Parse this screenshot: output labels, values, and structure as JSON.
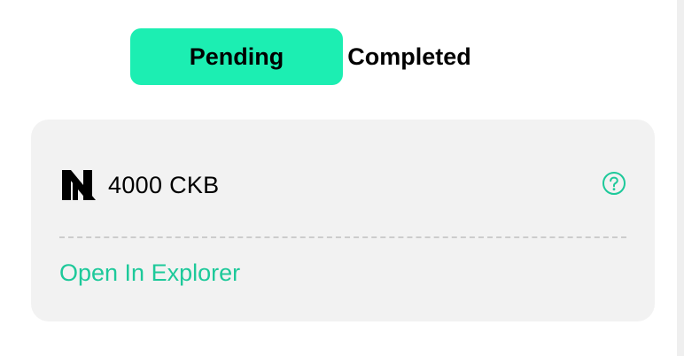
{
  "tabs": [
    {
      "label": "Pending",
      "active": true
    },
    {
      "label": "Completed",
      "active": false
    }
  ],
  "transaction": {
    "asset_icon": "nervos-logo-icon",
    "amount": "4000 CKB",
    "help_icon": "question-circle-icon",
    "explorer_link": "Open In Explorer"
  },
  "colors": {
    "accent": "#1ceeb2",
    "link": "#1dc99a",
    "card_background": "#f2f2f2"
  }
}
